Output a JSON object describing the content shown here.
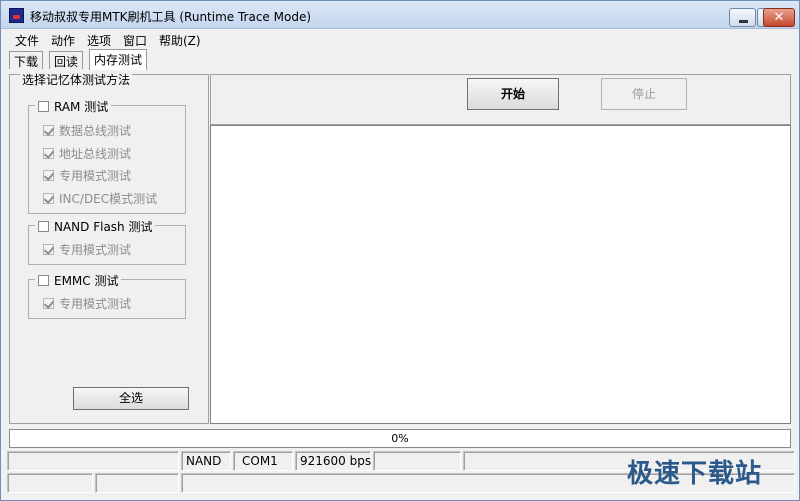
{
  "window": {
    "title": "移动叔叔专用MTK刷机工具 (Runtime Trace Mode)"
  },
  "titlebar_buttons": {
    "close_glyph": "✕"
  },
  "menu": [
    "文件",
    "动作",
    "选项",
    "窗口",
    "帮助(Z)"
  ],
  "tabs": [
    "下载",
    "回读",
    "内存测试"
  ],
  "left": {
    "title": "选择记忆体测试方法",
    "ram": {
      "label": "RAM 测试",
      "options": [
        "数据总线测试",
        "地址总线测试",
        "专用模式测试",
        "INC/DEC模式测试"
      ]
    },
    "nand": {
      "label": "NAND Flash 测试",
      "options": [
        "专用模式测试"
      ]
    },
    "emmc": {
      "label": "EMMC 测试",
      "options": [
        "专用模式测试"
      ]
    },
    "select_all": "全选"
  },
  "actions": {
    "start": "开始",
    "stop": "停止"
  },
  "progress": {
    "text": "0%",
    "value": 0
  },
  "status": {
    "storage": "NAND",
    "port": "COM1",
    "baud": "921600 bps"
  },
  "watermark": "极速下载站"
}
